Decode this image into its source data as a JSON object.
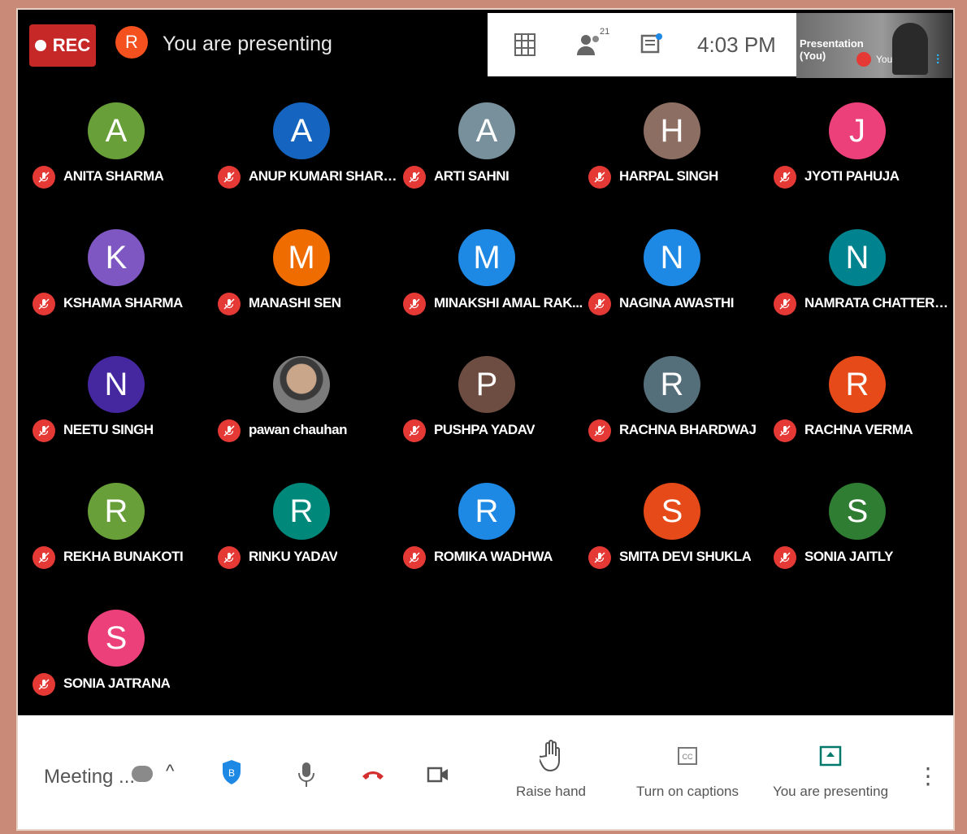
{
  "header": {
    "rec_label": "REC",
    "presenter_initial": "R",
    "presenting_text": "You are presenting",
    "time": "4:03 PM",
    "people_count": "21",
    "self_view_label": "Presentation (You)",
    "self_view_you": "You"
  },
  "participants": [
    {
      "initial": "A",
      "name": "ANITA SHARMA",
      "color": "#689f38"
    },
    {
      "initial": "A",
      "name": "ANUP KUMARI SHARMA",
      "color": "#1565c0"
    },
    {
      "initial": "A",
      "name": "ARTI SAHNI",
      "color": "#78909c"
    },
    {
      "initial": "H",
      "name": "HARPAL SINGH",
      "color": "#8d6e63"
    },
    {
      "initial": "J",
      "name": "JYOTI PAHUJA",
      "color": "#ec407a"
    },
    {
      "initial": "K",
      "name": "KSHAMA SHARMA",
      "color": "#7e57c2"
    },
    {
      "initial": "M",
      "name": "MANASHI SEN",
      "color": "#ef6c00"
    },
    {
      "initial": "M",
      "name": "MINAKSHI AMAL RAK...",
      "color": "#1e88e5"
    },
    {
      "initial": "N",
      "name": "NAGINA AWASTHI",
      "color": "#1e88e5"
    },
    {
      "initial": "N",
      "name": "NAMRATA CHATTERJEE",
      "color": "#00838f"
    },
    {
      "initial": "N",
      "name": "NEETU SINGH",
      "color": "#4527a0"
    },
    {
      "initial": "",
      "name": "pawan chauhan",
      "color": "#555555",
      "photo": true
    },
    {
      "initial": "P",
      "name": "PUSHPA YADAV",
      "color": "#6d4c41"
    },
    {
      "initial": "R",
      "name": "RACHNA BHARDWAJ",
      "color": "#546e7a"
    },
    {
      "initial": "R",
      "name": "RACHNA VERMA",
      "color": "#e64a19"
    },
    {
      "initial": "R",
      "name": "REKHA BUNAKOTI",
      "color": "#689f38"
    },
    {
      "initial": "R",
      "name": "RINKU YADAV",
      "color": "#00897b"
    },
    {
      "initial": "R",
      "name": "ROMIKA WADHWA",
      "color": "#1e88e5"
    },
    {
      "initial": "S",
      "name": "SMITA DEVI SHUKLA",
      "color": "#e64a19"
    },
    {
      "initial": "S",
      "name": "SONIA JAITLY",
      "color": "#2e7d32"
    },
    {
      "initial": "S",
      "name": "SONIA JATRANA",
      "color": "#ec407a"
    }
  ],
  "bottom": {
    "meeting_label": "Meeting ...",
    "raise_hand": "Raise hand",
    "captions": "Turn on captions",
    "presenting": "You are presenting"
  }
}
